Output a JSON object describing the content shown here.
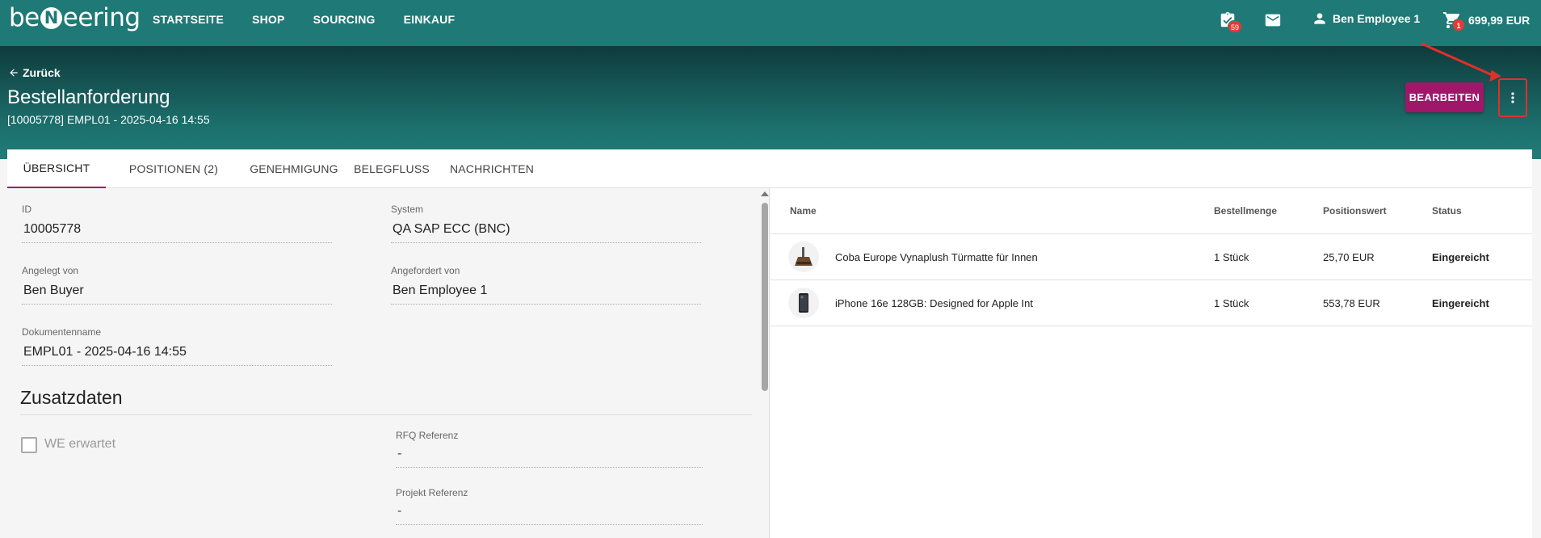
{
  "topbar": {
    "logo": "beNeering",
    "nav": [
      "STARTSEITE",
      "SHOP",
      "SOURCING",
      "EINKAUF"
    ],
    "tasks_badge": "59",
    "user_name": "Ben Employee 1",
    "cart_badge": "1",
    "cart_total": "699,99 EUR"
  },
  "header": {
    "back_label": "Zurück",
    "title": "Bestellanforderung",
    "subtitle": "[10005778] EMPL01 - 2025-04-16 14:55",
    "edit_label": "BEARBEITEN"
  },
  "tabs": [
    "ÜBERSICHT",
    "POSITIONEN (2)",
    "GENEHMIGUNG",
    "BELEGFLUSS",
    "NACHRICHTEN"
  ],
  "overview": {
    "id_label": "ID",
    "id_value": "10005778",
    "system_label": "System",
    "system_value": "QA SAP ECC (BNC)",
    "created_by_label": "Angelegt von",
    "created_by_value": "Ben Buyer",
    "requested_by_label": "Angefordert von",
    "requested_by_value": "Ben Employee 1",
    "docname_label": "Dokumentenname",
    "docname_value": "EMPL01 - 2025-04-16 14:55"
  },
  "extra": {
    "title": "Zusatzdaten",
    "we_label": "WE erwartet",
    "rfq_label": "RFQ Referenz",
    "rfq_value": "-",
    "project_label": "Projekt Referenz",
    "project_value": "-"
  },
  "positions": {
    "headers": {
      "name": "Name",
      "qty": "Bestellmenge",
      "value": "Positionswert",
      "status": "Status"
    },
    "rows": [
      {
        "name": "Coba Europe Vynaplush Türmatte für Innen",
        "qty": "1 Stück",
        "value": "25,70 EUR",
        "status": "Eingereicht"
      },
      {
        "name": "iPhone 16e 128GB: Designed for Apple Int",
        "qty": "1 Stück",
        "value": "553,78 EUR",
        "status": "Eingereicht"
      }
    ]
  },
  "colors": {
    "topbar": "#1f7a77",
    "accent": "#a0176a",
    "highlight": "#e0302a"
  }
}
